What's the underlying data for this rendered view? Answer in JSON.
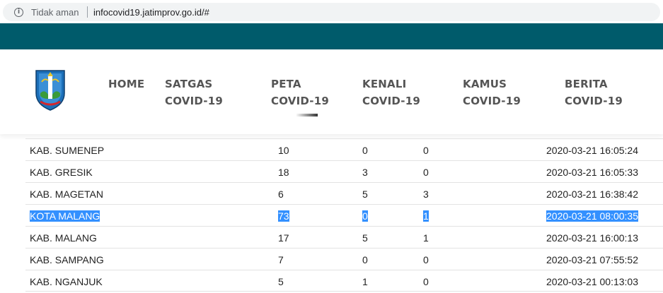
{
  "browser": {
    "security_label": "Tidak aman",
    "url": "infocovid19.jatimprov.go.id/#"
  },
  "nav": {
    "home": "HOME",
    "satgas": [
      "SATGAS",
      "COVID-19"
    ],
    "peta": [
      "PETA",
      "COVID-19"
    ],
    "kenali": [
      "KENALI",
      "COVID-19"
    ],
    "kamus": [
      "KAMUS",
      "COVID-19"
    ],
    "berita": [
      "BERITA",
      "COVID-19"
    ],
    "active": "peta"
  },
  "table": {
    "rows": [
      {
        "name": "KAB. SUMENEP",
        "a": "10",
        "b": "0",
        "c": "0",
        "time": "2020-03-21 16:05:24",
        "selected": false
      },
      {
        "name": "KAB. GRESIK",
        "a": "18",
        "b": "3",
        "c": "0",
        "time": "2020-03-21 16:05:33",
        "selected": false
      },
      {
        "name": "KAB. MAGETAN",
        "a": "6",
        "b": "5",
        "c": "3",
        "time": "2020-03-21 16:38:42",
        "selected": false
      },
      {
        "name": "KOTA MALANG",
        "a": "73",
        "b": "0",
        "c": "1",
        "time": "2020-03-21 08:00:35",
        "selected": true
      },
      {
        "name": "KAB. MALANG",
        "a": "17",
        "b": "5",
        "c": "1",
        "time": "2020-03-21 16:00:13",
        "selected": false
      },
      {
        "name": "KAB. SAMPANG",
        "a": "7",
        "b": "0",
        "c": "0",
        "time": "2020-03-21 07:55:52",
        "selected": false
      },
      {
        "name": "KAB. NGANJUK",
        "a": "5",
        "b": "1",
        "c": "0",
        "time": "2020-03-21 00:13:03",
        "selected": false
      }
    ]
  },
  "colors": {
    "teal": "#005b6b",
    "selection": "#3390ff"
  }
}
